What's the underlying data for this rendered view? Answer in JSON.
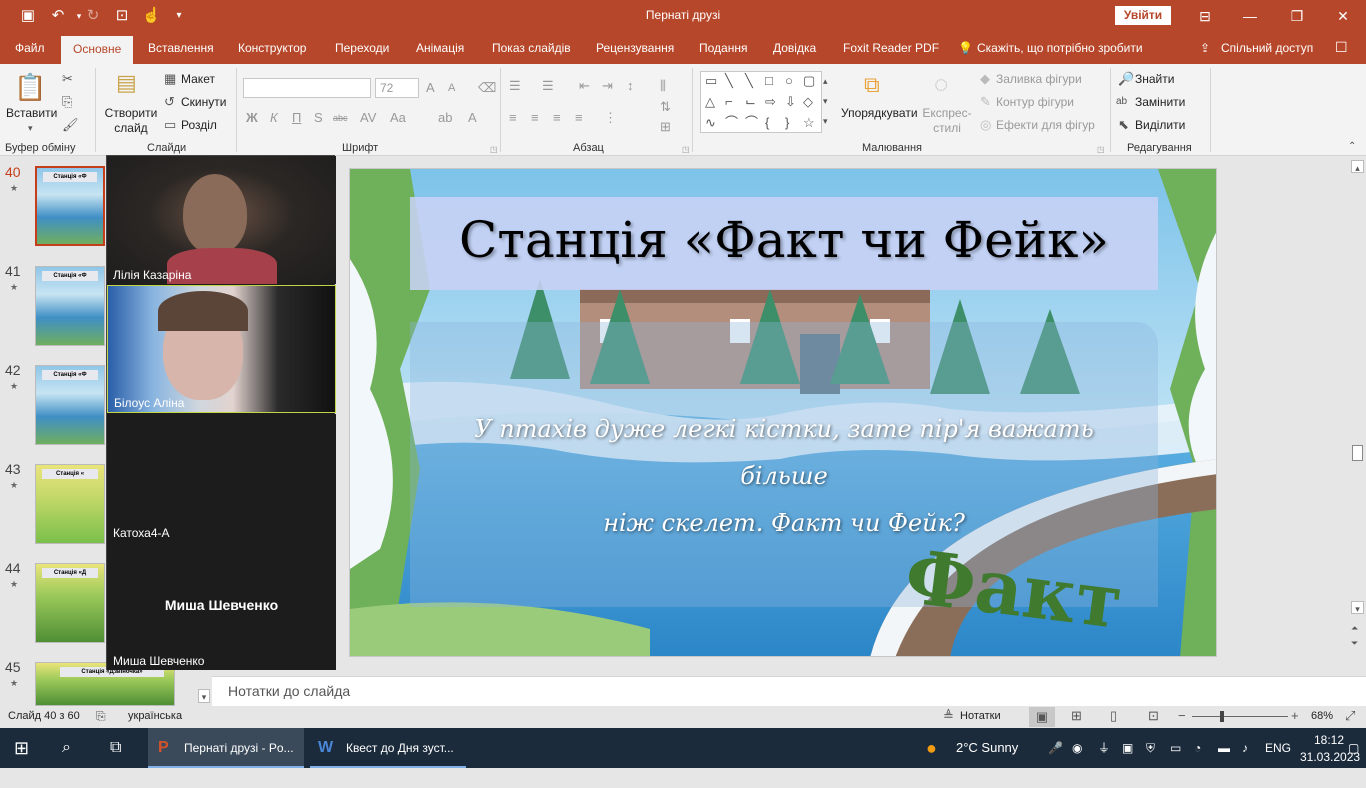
{
  "window": {
    "title": "Пернаті друзі",
    "signin": "Увійти"
  },
  "ribbon_tabs": [
    "Файл",
    "Основне",
    "Вставлення",
    "Конструктор",
    "Переходи",
    "Анімація",
    "Показ слайдів",
    "Рецензування",
    "Подання",
    "Довідка",
    "Foxit Reader PDF",
    "Скажіть, що потрібно зробити",
    "Спільний доступ"
  ],
  "ribbon": {
    "paste": "Вставити",
    "new_slide": "Створити слайд",
    "layout": "Макет",
    "reset": "Скинути",
    "section": "Розділ",
    "font_size": "72",
    "arrange": "Упорядкувати",
    "quick_styles": "Експрес-стилі",
    "shape_fill": "Заливка фігури",
    "shape_outline": "Контур фігури",
    "shape_effects": "Ефекти для фігур",
    "find": "Знайти",
    "replace": "Замінити",
    "select": "Виділити",
    "groups": [
      "Буфер обміну",
      "Слайди",
      "Шрифт",
      "Абзац",
      "Малювання",
      "Редагування"
    ]
  },
  "thumbnails": [
    {
      "num": "40",
      "title": "Станція «Ф"
    },
    {
      "num": "41",
      "title": "Станція «Ф"
    },
    {
      "num": "42",
      "title": "Станція «Ф"
    },
    {
      "num": "43",
      "title": "Станція «"
    },
    {
      "num": "44",
      "title": "Станція «Д"
    },
    {
      "num": "45",
      "title": "Станція «Дзвіночка»"
    }
  ],
  "participants": [
    {
      "name": "Лілія Казаріна"
    },
    {
      "name": "Білоус Аліна"
    },
    {
      "name": "Катоха4-А"
    },
    {
      "name": "Миша Шевченко",
      "center": "Миша Шевченко"
    }
  ],
  "slide": {
    "title": "Станція «Факт чи Фейк»",
    "question_line1": "У птахів дуже легкі кістки, зате пір'я важать більше",
    "question_line2": "ніж скелет. Факт чи Фейк?",
    "answer": "Факт"
  },
  "notes": "Нотатки до слайда",
  "status": {
    "slide": "Слайд 40 з 60",
    "lang": "українська",
    "notes_btn": "Нотатки",
    "zoom": "68%"
  },
  "taskbar": {
    "apps": [
      {
        "label": "Пернаті друзі - Po..."
      },
      {
        "label": "Квест  до Дня зуст..."
      }
    ],
    "weather": "2°C  Sunny",
    "lang": "ENG",
    "time": "18:12",
    "date": "31.03.2023"
  },
  "colors": {
    "accent": "#b7472a",
    "selected": "#c43e1c",
    "answer": "#3f7a2e"
  }
}
